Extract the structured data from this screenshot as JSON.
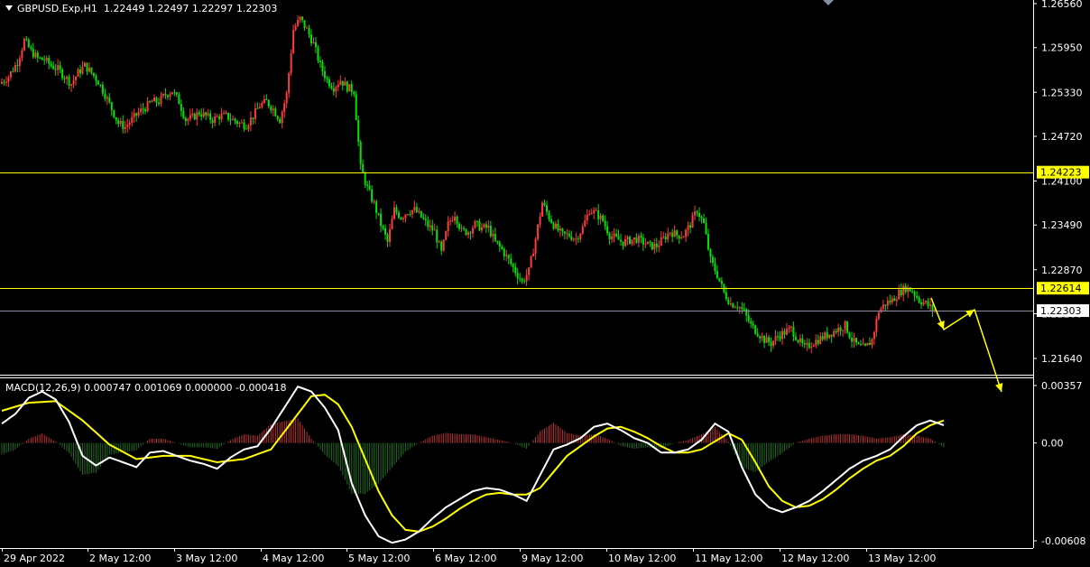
{
  "header": {
    "symbol": "GBPUSD.Exp,H1",
    "ohlc": "1.22449 1.22497 1.22297 1.22303"
  },
  "macd_header": {
    "label": "MACD(12,26,9) 0.000747 0.001069 0.000000 -0.000418"
  },
  "colors": {
    "background": "#000000",
    "bull": "#ff3b3b",
    "bear": "#00e400",
    "macd_line": "#ffffff",
    "signal_line": "#ffff00",
    "level_line": "#ffff00",
    "price_line": "#8c8ca0",
    "annotation": "#ffff00"
  },
  "chart_data": [
    {
      "type": "candlestick",
      "symbol": "GBPUSD.Exp",
      "timeframe": "H1",
      "y_ticks": [
        "1.26560",
        "1.25950",
        "1.25330",
        "1.24720",
        "1.24100",
        "1.23490",
        "1.22870",
        "1.22260",
        "1.21640"
      ],
      "ylim": [
        1.2115,
        1.2656
      ],
      "x_ticks": [
        "29 Apr 2022",
        "2 May 12:00",
        "3 May 12:00",
        "4 May 12:00",
        "5 May 12:00",
        "6 May 12:00",
        "9 May 12:00",
        "10 May 12:00",
        "11 May 12:00",
        "12 May 12:00",
        "13 May 12:00"
      ],
      "levels": [
        {
          "label": "1.24223",
          "value": 1.24223,
          "style": "yellow-box"
        },
        {
          "label": "1.22614",
          "value": 1.22614,
          "style": "yellow-box"
        },
        {
          "label": "1.22303",
          "value": 1.22303,
          "style": "current-price"
        }
      ],
      "path": [
        [
          0,
          1.2545
        ],
        [
          4,
          1.2555
        ],
        [
          8,
          1.2575
        ],
        [
          11,
          1.2605
        ],
        [
          14,
          1.259
        ],
        [
          17,
          1.258
        ],
        [
          20,
          1.2578
        ],
        [
          23,
          1.257
        ],
        [
          26,
          1.2565
        ],
        [
          29,
          1.2555
        ],
        [
          32,
          1.2545
        ],
        [
          35,
          1.256
        ],
        [
          38,
          1.257
        ],
        [
          41,
          1.256
        ],
        [
          44,
          1.2548
        ],
        [
          47,
          1.253
        ],
        [
          50,
          1.251
        ],
        [
          53,
          1.249
        ],
        [
          56,
          1.2485
        ],
        [
          59,
          1.2495
        ],
        [
          62,
          1.2505
        ],
        [
          65,
          1.2512
        ],
        [
          68,
          1.252
        ],
        [
          71,
          1.252
        ],
        [
          74,
          1.253
        ],
        [
          77,
          1.2535
        ],
        [
          80,
          1.252
        ],
        [
          83,
          1.2495
        ],
        [
          86,
          1.2498
        ],
        [
          89,
          1.2505
        ],
        [
          92,
          1.25
        ],
        [
          95,
          1.2495
        ],
        [
          98,
          1.25
        ],
        [
          101,
          1.25
        ],
        [
          104,
          1.2495
        ],
        [
          107,
          1.249
        ],
        [
          110,
          1.2488
        ],
        [
          113,
          1.25
        ],
        [
          116,
          1.2515
        ],
        [
          119,
          1.252
        ],
        [
          122,
          1.251
        ],
        [
          125,
          1.2495
        ],
        [
          128,
          1.253
        ],
        [
          131,
          1.262
        ],
        [
          134,
          1.2635
        ],
        [
          137,
          1.262
        ],
        [
          140,
          1.26
        ],
        [
          143,
          1.257
        ],
        [
          146,
          1.255
        ],
        [
          149,
          1.254
        ],
        [
          152,
          1.255
        ],
        [
          155,
          1.254
        ],
        [
          158,
          1.2535
        ],
        [
          161,
          1.2428
        ],
        [
          164,
          1.24
        ],
        [
          167,
          1.2378
        ],
        [
          170,
          1.235
        ],
        [
          173,
          1.2325
        ],
        [
          176,
          1.237
        ],
        [
          179,
          1.236
        ],
        [
          182,
          1.2368
        ],
        [
          185,
          1.237
        ],
        [
          188,
          1.236
        ],
        [
          191,
          1.2348
        ],
        [
          194,
          1.234
        ],
        [
          197,
          1.231
        ],
        [
          200,
          1.235
        ],
        [
          203,
          1.2365
        ],
        [
          206,
          1.234
        ],
        [
          209,
          1.234
        ],
        [
          212,
          1.235
        ],
        [
          215,
          1.2345
        ],
        [
          218,
          1.2345
        ],
        [
          221,
          1.2325
        ],
        [
          224,
          1.2315
        ],
        [
          227,
          1.23
        ],
        [
          230,
          1.2285
        ],
        [
          233,
          1.227
        ],
        [
          236,
          1.2285
        ],
        [
          239,
          1.233
        ],
        [
          242,
          1.238
        ],
        [
          245,
          1.236
        ],
        [
          248,
          1.2345
        ],
        [
          251,
          1.2335
        ],
        [
          254,
          1.2335
        ],
        [
          257,
          1.233
        ],
        [
          260,
          1.2345
        ],
        [
          263,
          1.237
        ],
        [
          266,
          1.2365
        ],
        [
          269,
          1.2355
        ],
        [
          272,
          1.2335
        ],
        [
          275,
          1.233
        ],
        [
          278,
          1.2325
        ],
        [
          281,
          1.2328
        ],
        [
          284,
          1.233
        ],
        [
          287,
          1.2325
        ],
        [
          290,
          1.232
        ],
        [
          293,
          1.232
        ],
        [
          296,
          1.233
        ],
        [
          299,
          1.234
        ],
        [
          302,
          1.2335
        ],
        [
          305,
          1.2335
        ],
        [
          308,
          1.235
        ],
        [
          311,
          1.237
        ],
        [
          314,
          1.235
        ],
        [
          317,
          1.23
        ],
        [
          320,
          1.228
        ],
        [
          323,
          1.2255
        ],
        [
          326,
          1.224
        ],
        [
          329,
          1.2238
        ],
        [
          332,
          1.2228
        ],
        [
          335,
          1.221
        ],
        [
          338,
          1.22
        ],
        [
          341,
          1.219
        ],
        [
          344,
          1.2185
        ],
        [
          347,
          1.2195
        ],
        [
          350,
          1.22
        ],
        [
          353,
          1.2205
        ],
        [
          356,
          1.219
        ],
        [
          359,
          1.2178
        ],
        [
          362,
          1.2185
        ],
        [
          365,
          1.219
        ],
        [
          368,
          1.2195
        ],
        [
          371,
          1.22
        ],
        [
          374,
          1.2205
        ],
        [
          377,
          1.221
        ],
        [
          380,
          1.219
        ],
        [
          383,
          1.218
        ],
        [
          386,
          1.2178
        ],
        [
          389,
          1.219
        ],
        [
          392,
          1.223
        ],
        [
          395,
          1.224
        ],
        [
          398,
          1.2245
        ],
        [
          401,
          1.2255
        ],
        [
          404,
          1.2262
        ],
        [
          407,
          1.2258
        ],
        [
          410,
          1.2245
        ],
        [
          413,
          1.224
        ],
        [
          416,
          1.2232
        ]
      ],
      "annotation_arrow": [
        [
          1032,
          330
        ],
        [
          1046,
          365
        ],
        [
          1080,
          343
        ],
        [
          1110,
          434
        ]
      ]
    },
    {
      "type": "macd",
      "name": "MACD(12,26,9)",
      "y_ticks": [
        "0.00357",
        "0.00",
        "-0.00608"
      ],
      "ylim": [
        -0.0066,
        0.0039
      ],
      "macd": [
        [
          0,
          0.0012
        ],
        [
          6,
          0.0018
        ],
        [
          12,
          0.0028
        ],
        [
          18,
          0.0032
        ],
        [
          24,
          0.0027
        ],
        [
          30,
          0.0013
        ],
        [
          36,
          -0.0008
        ],
        [
          42,
          -0.0014
        ],
        [
          48,
          -0.0009
        ],
        [
          54,
          -0.0012
        ],
        [
          60,
          -0.0015
        ],
        [
          66,
          -0.0006
        ],
        [
          72,
          -0.0005
        ],
        [
          78,
          -0.0008
        ],
        [
          84,
          -0.0011
        ],
        [
          90,
          -0.0013
        ],
        [
          96,
          -0.0016
        ],
        [
          102,
          -0.0009
        ],
        [
          108,
          -0.0004
        ],
        [
          114,
          -0.0002
        ],
        [
          120,
          0.0009
        ],
        [
          126,
          0.0022
        ],
        [
          132,
          0.0035
        ],
        [
          138,
          0.0032
        ],
        [
          144,
          0.0022
        ],
        [
          150,
          0.0008
        ],
        [
          156,
          -0.0025
        ],
        [
          162,
          -0.0045
        ],
        [
          168,
          -0.0058
        ],
        [
          174,
          -0.0062
        ],
        [
          180,
          -0.006
        ],
        [
          186,
          -0.0055
        ],
        [
          192,
          -0.0047
        ],
        [
          198,
          -0.004
        ],
        [
          204,
          -0.0035
        ],
        [
          210,
          -0.003
        ],
        [
          216,
          -0.0028
        ],
        [
          222,
          -0.0029
        ],
        [
          228,
          -0.0032
        ],
        [
          234,
          -0.0036
        ],
        [
          240,
          -0.002
        ],
        [
          246,
          -0.0004
        ],
        [
          252,
          -0.0001
        ],
        [
          258,
          0.0003
        ],
        [
          264,
          0.001
        ],
        [
          270,
          0.0012
        ],
        [
          276,
          0.0008
        ],
        [
          282,
          0.0003
        ],
        [
          288,
          0.0
        ],
        [
          294,
          -0.0006
        ],
        [
          300,
          -0.0006
        ],
        [
          306,
          -0.0004
        ],
        [
          312,
          0.0002
        ],
        [
          318,
          0.0012
        ],
        [
          324,
          0.0007
        ],
        [
          330,
          -0.0015
        ],
        [
          336,
          -0.0032
        ],
        [
          342,
          -0.004
        ],
        [
          348,
          -0.0043
        ],
        [
          354,
          -0.004
        ],
        [
          360,
          -0.0036
        ],
        [
          366,
          -0.003
        ],
        [
          372,
          -0.0023
        ],
        [
          378,
          -0.0016
        ],
        [
          384,
          -0.0011
        ],
        [
          390,
          -0.0008
        ],
        [
          396,
          -0.0004
        ],
        [
          402,
          0.0004
        ],
        [
          408,
          0.0011
        ],
        [
          414,
          0.0014
        ],
        [
          420,
          0.0011
        ]
      ],
      "signal": [
        [
          0,
          0.002
        ],
        [
          12,
          0.0025
        ],
        [
          24,
          0.0026
        ],
        [
          36,
          0.0014
        ],
        [
          48,
          -0.0001
        ],
        [
          60,
          -0.001
        ],
        [
          72,
          -0.0008
        ],
        [
          84,
          -0.0008
        ],
        [
          96,
          -0.0012
        ],
        [
          108,
          -0.001
        ],
        [
          120,
          -0.0004
        ],
        [
          132,
          0.0018
        ],
        [
          138,
          0.0029
        ],
        [
          144,
          0.003
        ],
        [
          150,
          0.0024
        ],
        [
          156,
          0.001
        ],
        [
          162,
          -0.001
        ],
        [
          168,
          -0.003
        ],
        [
          174,
          -0.0045
        ],
        [
          180,
          -0.0054
        ],
        [
          186,
          -0.0055
        ],
        [
          192,
          -0.0052
        ],
        [
          198,
          -0.0047
        ],
        [
          204,
          -0.0041
        ],
        [
          210,
          -0.0036
        ],
        [
          216,
          -0.0032
        ],
        [
          222,
          -0.0031
        ],
        [
          228,
          -0.0032
        ],
        [
          234,
          -0.0032
        ],
        [
          240,
          -0.0028
        ],
        [
          246,
          -0.0018
        ],
        [
          252,
          -0.0008
        ],
        [
          258,
          -0.0002
        ],
        [
          264,
          0.0004
        ],
        [
          270,
          0.0009
        ],
        [
          276,
          0.001
        ],
        [
          282,
          0.0007
        ],
        [
          288,
          0.0003
        ],
        [
          294,
          -0.0002
        ],
        [
          300,
          -0.0006
        ],
        [
          306,
          -0.0006
        ],
        [
          312,
          -0.0004
        ],
        [
          318,
          0.0001
        ],
        [
          324,
          0.0006
        ],
        [
          330,
          0.0002
        ],
        [
          336,
          -0.0012
        ],
        [
          342,
          -0.0027
        ],
        [
          348,
          -0.0036
        ],
        [
          354,
          -0.004
        ],
        [
          360,
          -0.0039
        ],
        [
          366,
          -0.0035
        ],
        [
          372,
          -0.0029
        ],
        [
          378,
          -0.0022
        ],
        [
          384,
          -0.0016
        ],
        [
          390,
          -0.0011
        ],
        [
          396,
          -0.0008
        ],
        [
          402,
          -0.0002
        ],
        [
          408,
          0.0006
        ],
        [
          414,
          0.0011
        ],
        [
          420,
          0.0014
        ]
      ]
    }
  ]
}
